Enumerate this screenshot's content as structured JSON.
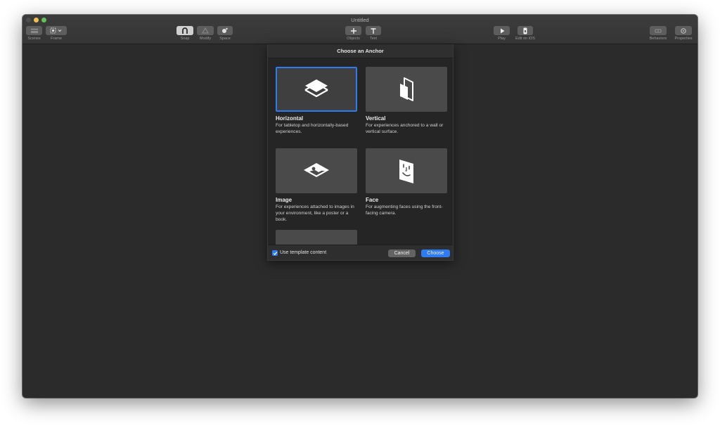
{
  "window": {
    "title": "Untitled"
  },
  "toolbar": {
    "scenes": "Scenes",
    "frame": "Frame",
    "snap": "Snap",
    "modify": "Modify",
    "space": "Space",
    "objects": "Objects",
    "text": "Text",
    "play": "Play",
    "edit_on_ios": "Edit on iOS",
    "behaviors": "Behaviors",
    "properties": "Properties"
  },
  "dialog": {
    "title": "Choose an Anchor",
    "anchors": [
      {
        "name": "Horizontal",
        "description": "For tabletop and horizontally-based experiences.",
        "icon": "horizontal-plane-icon",
        "selected": true
      },
      {
        "name": "Vertical",
        "description": "For experiences anchored to a wall or vertical surface.",
        "icon": "vertical-plane-icon",
        "selected": false
      },
      {
        "name": "Image",
        "description": "For experiences attached to images in your environment, like a poster or a book.",
        "icon": "image-anchor-icon",
        "selected": false
      },
      {
        "name": "Face",
        "description": "For augmenting faces using the front-facing camera.",
        "icon": "face-anchor-icon",
        "selected": false
      }
    ],
    "use_template_label": "Use template content",
    "use_template_checked": true,
    "cancel_label": "Cancel",
    "choose_label": "Choose"
  },
  "colors": {
    "accent": "#2f7bf1",
    "background": "#2b2b2b"
  }
}
